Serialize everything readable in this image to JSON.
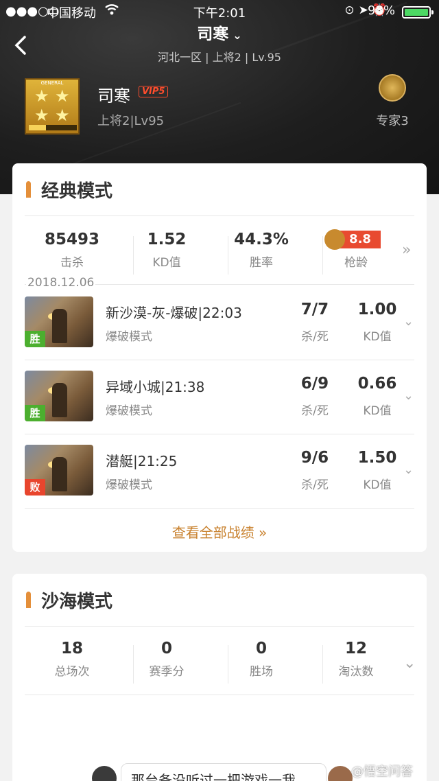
{
  "status_bar": {
    "signal": "●●●○○",
    "carrier": "中国移动",
    "time": "下午2:01",
    "battery": "98%"
  },
  "header": {
    "title": "司寒",
    "subtitle": "河北一区 | 上将2 | Lv.95",
    "rank_badge_label": "GENERAL",
    "player_name": "司寒",
    "vip_label": "VIP5",
    "player_rank": "上将2|Lv95",
    "expert_label": "专家3"
  },
  "classic": {
    "title": "经典模式",
    "stats": [
      {
        "value": "85493",
        "label": "击杀"
      },
      {
        "value": "1.52",
        "label": "KD值"
      },
      {
        "value": "44.3%",
        "label": "胜率"
      },
      {
        "value": "8.8",
        "label": "枪龄"
      }
    ],
    "date": "2018.12.06",
    "matches": [
      {
        "name": "新沙漠-灰-爆破|22:03",
        "mode": "爆破模式",
        "kills_deaths": "7/7",
        "kd_label": "杀/死",
        "ratio": "1.00",
        "ratio_label": "KD值",
        "result": "胜",
        "result_color": "#4caf2f"
      },
      {
        "name": "异域小城|21:38",
        "mode": "爆破模式",
        "kills_deaths": "6/9",
        "kd_label": "杀/死",
        "ratio": "0.66",
        "ratio_label": "KD值",
        "result": "胜",
        "result_color": "#4caf2f"
      },
      {
        "name": "潜艇|21:25",
        "mode": "爆破模式",
        "kills_deaths": "9/6",
        "kd_label": "杀/死",
        "ratio": "1.50",
        "ratio_label": "KD值",
        "result": "败",
        "result_color": "#e8452d"
      }
    ],
    "view_all": "查看全部战绩 »"
  },
  "desert": {
    "title": "沙海模式",
    "stats": [
      {
        "value": "18",
        "label": "总场次"
      },
      {
        "value": "0",
        "label": "赛季分"
      },
      {
        "value": "0",
        "label": "胜场"
      },
      {
        "value": "12",
        "label": "淘汰数"
      }
    ]
  },
  "footer": {
    "bubble_text": "那台备没听过一把游戏一我",
    "watermark": "@悟空问答"
  }
}
